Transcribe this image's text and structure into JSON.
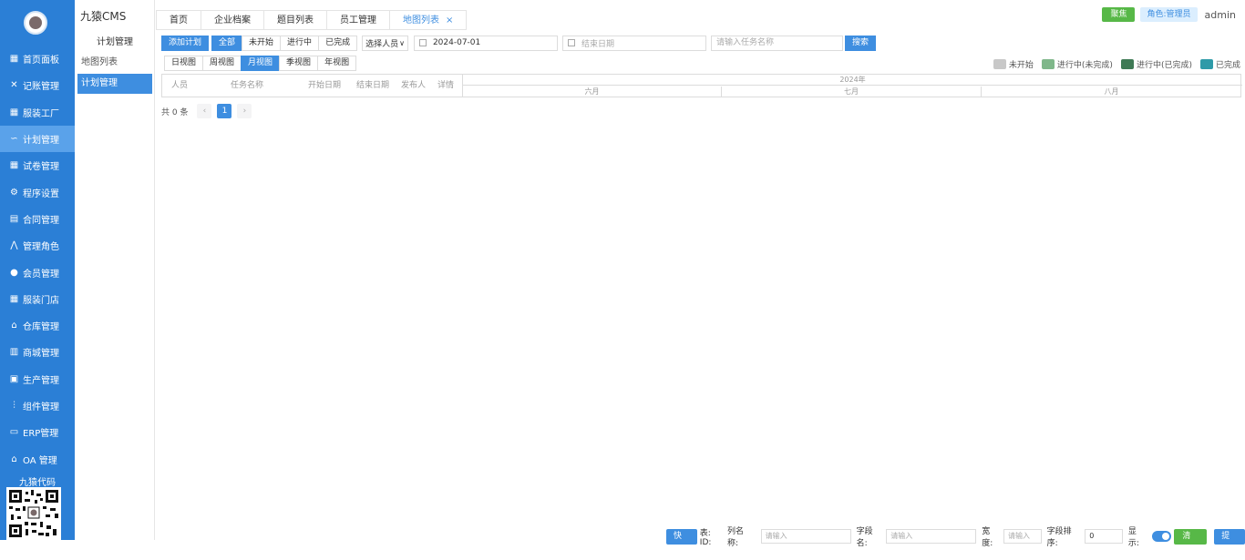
{
  "app": {
    "brand": "九猿CMS"
  },
  "nav": {
    "items": [
      {
        "label": "首页面板",
        "icon": "grid-icon"
      },
      {
        "label": "记账管理",
        "icon": "tools-icon"
      },
      {
        "label": "服装工厂",
        "icon": "grid-icon"
      },
      {
        "label": "计划管理",
        "icon": "plan-icon",
        "active": true
      },
      {
        "label": "试卷管理",
        "icon": "grid-icon"
      },
      {
        "label": "程序设置",
        "icon": "gear-icon"
      },
      {
        "label": "合同管理",
        "icon": "contract-icon"
      },
      {
        "label": "管理角色",
        "icon": "role-icon"
      },
      {
        "label": "会员管理",
        "icon": "member-icon"
      },
      {
        "label": "服装门店",
        "icon": "grid-icon"
      },
      {
        "label": "仓库管理",
        "icon": "warehouse-icon"
      },
      {
        "label": "商城管理",
        "icon": "store-icon"
      },
      {
        "label": "生产管理",
        "icon": "production-icon"
      },
      {
        "label": "组件管理",
        "icon": "sliders-icon"
      },
      {
        "label": "ERP管理",
        "icon": "erp-icon"
      },
      {
        "label": "OA 管理",
        "icon": "building-icon"
      }
    ],
    "qr_title": "九猿代码"
  },
  "subnav": {
    "header": "计划管理",
    "items": [
      {
        "label": "地图列表"
      },
      {
        "label": "计划管理",
        "active": true
      }
    ]
  },
  "tabs": [
    {
      "label": "首页"
    },
    {
      "label": "企业档案"
    },
    {
      "label": "题目列表"
    },
    {
      "label": "员工管理"
    },
    {
      "label": "地图列表",
      "active": true,
      "close": "×"
    }
  ],
  "topright": {
    "collect": "聚焦",
    "role": "角色:管理员",
    "user": "admin"
  },
  "toolbar": {
    "add": "添加计划",
    "filters": [
      "全部",
      "未开始",
      "进行中",
      "已完成"
    ],
    "person_select": "选择人员",
    "start_date": "2024-07-01",
    "end_date_placeholder": "结束日期",
    "task_placeholder": "请输入任务名称",
    "search": "搜索"
  },
  "views": [
    "日视图",
    "周视图",
    "月视图",
    "季视图",
    "年视图"
  ],
  "legend": [
    {
      "label": "未开始",
      "color": "#c8c8c8"
    },
    {
      "label": "进行中(未完成)",
      "color": "#7fb78a"
    },
    {
      "label": "进行中(已完成)",
      "color": "#3f7a55"
    },
    {
      "label": "已完成",
      "color": "#2e9aa8"
    }
  ],
  "gantt": {
    "columns": [
      "人员",
      "任务名称",
      "开始日期",
      "结束日期",
      "发布人",
      "详情"
    ],
    "year": "2024年",
    "months": [
      "六月",
      "七月",
      "八月"
    ]
  },
  "pager": {
    "total": "共 0 条",
    "prev": "‹",
    "page": "1",
    "next": "›"
  },
  "bottom": {
    "quick": "快捷",
    "table_id": "表: ID:",
    "col_label": "列名称:",
    "col_placeholder": "请输入",
    "field_label": "字段名:",
    "field_placeholder": "请输入",
    "width_label": "宽度:",
    "width_placeholder": "请输入",
    "sort_label": "字段排序:",
    "sort_value": "0",
    "show_label": "显示:",
    "clear": "清空",
    "submit": "提交"
  }
}
